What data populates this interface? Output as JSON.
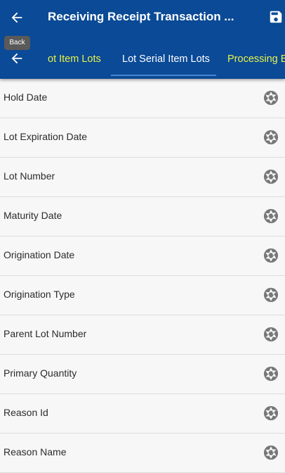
{
  "header": {
    "title": "Receiving Receipt Transaction ...",
    "back_tooltip": "Back",
    "back_icon": "arrow-left-icon",
    "save_icon": "floppy-disk-icon"
  },
  "tabs": [
    {
      "label": "ot Item Lots",
      "active": false
    },
    {
      "label": "Lot Serial Item Lots",
      "active": true
    },
    {
      "label": "Processing E",
      "active": false
    }
  ],
  "fields": [
    {
      "label": "Hold Date"
    },
    {
      "label": "Lot Expiration Date"
    },
    {
      "label": "Lot Number"
    },
    {
      "label": "Maturity Date"
    },
    {
      "label": "Origination Date"
    },
    {
      "label": "Origination Type"
    },
    {
      "label": "Parent Lot Number"
    },
    {
      "label": "Primary Quantity"
    },
    {
      "label": "Reason Id"
    },
    {
      "label": "Reason Name"
    }
  ],
  "colors": {
    "appbar": "#0a4a96",
    "tab_active_text": "#ffffff",
    "tab_inactive_text": "#e8f24a",
    "row_background": "#f7f7f7",
    "icon_gray": "#777777"
  },
  "row_icon": "camera-aperture-icon"
}
